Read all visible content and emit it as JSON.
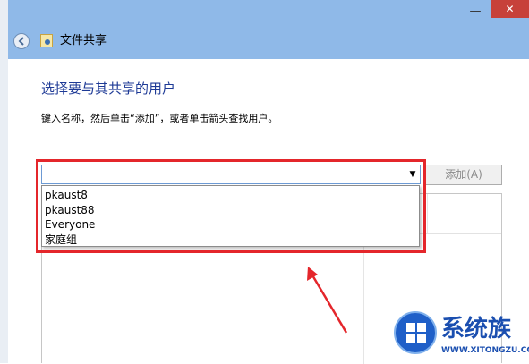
{
  "window": {
    "title": "文件共享",
    "minimize_glyph": "—",
    "close_glyph": "✕"
  },
  "nav": {
    "back_icon": "back-arrow-icon",
    "title_icon": "file-sharing-icon"
  },
  "content": {
    "heading": "选择要与其共享的用户",
    "instruction": "键入名称，然后单击“添加”，或者单击箭头查找用户。"
  },
  "combo": {
    "value": "",
    "dropdown_icon": "chevron-down-icon",
    "dropdown_glyph": "▼",
    "options": [
      "pkaust8",
      "pkaust88",
      "Everyone",
      "家庭组"
    ]
  },
  "add_button": {
    "label": "添加(A)",
    "enabled": false
  },
  "annotation": {
    "highlight_color": "#e4262b"
  },
  "watermark": {
    "brand": "系统族",
    "url": "WWW.XITONGZU.COM"
  }
}
